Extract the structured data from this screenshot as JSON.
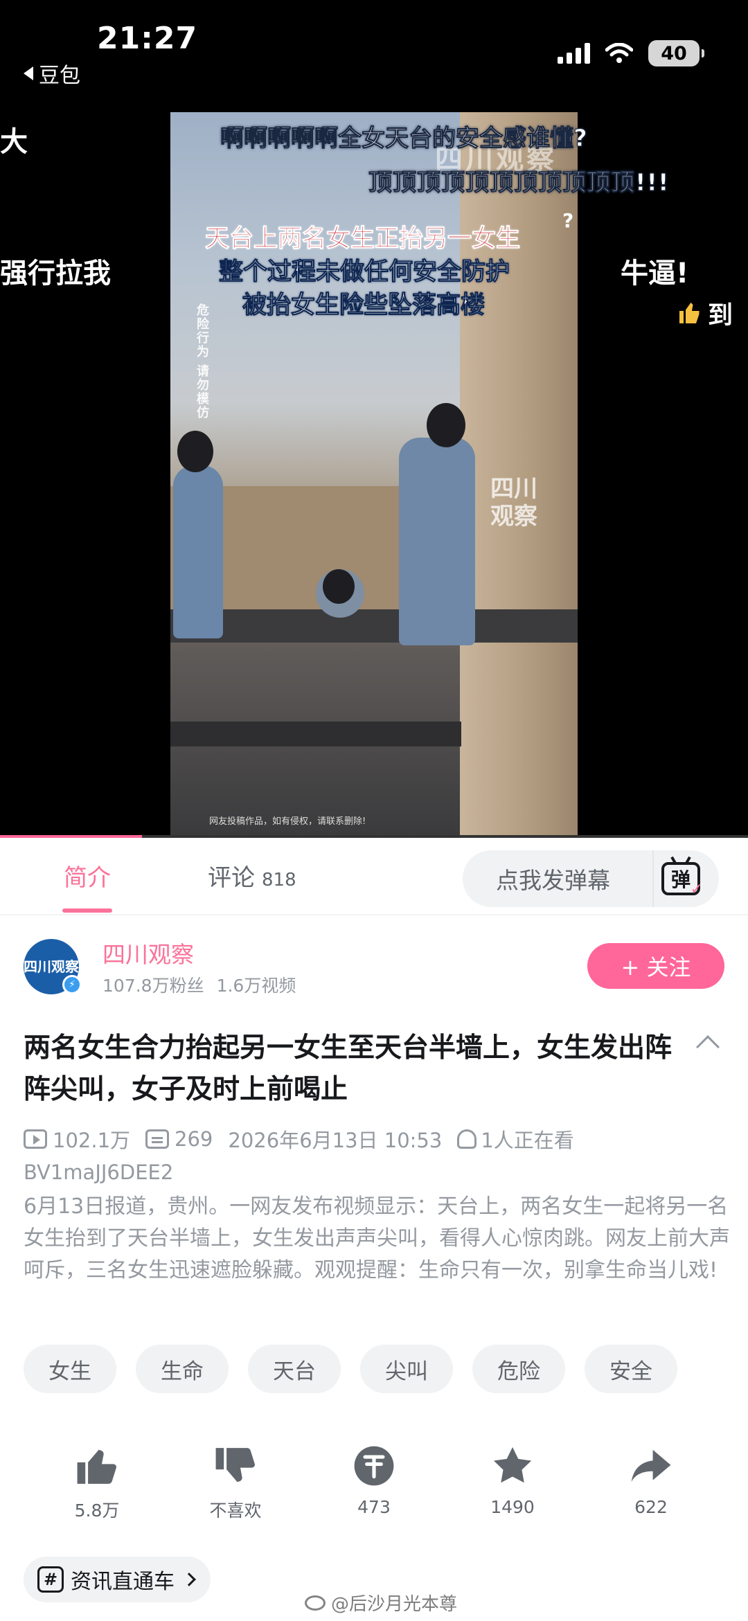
{
  "status_bar": {
    "time": "21:27",
    "back_app": "豆包",
    "battery": "40"
  },
  "video": {
    "overlay_top_line1": "啊啊啊啊啊全女天台的安全感谁懂?",
    "overlay_top_line2": "顶顶顶顶顶顶顶顶顶顶顶!!!",
    "overlay_question": "?",
    "caption_red": "天台上两名女生正抬另一女生",
    "caption_white_1": "整个过程未做任何安全防护",
    "caption_white_2": "被抬女生险些坠落高楼",
    "vertical_warning": "危险行为 请勿模仿",
    "watermark_top": "四川观察",
    "watermark_mid": "四川观察",
    "disclaimer": "网友投稿作品，如有侵权，请联系删除!",
    "progress": 0.19
  },
  "danmaku": {
    "left_top": "大",
    "left_mid": "强行拉我",
    "right_mid": "牛逼!",
    "right_lower": "到"
  },
  "tabs": {
    "intro": "简介",
    "comments": "评论",
    "comments_count": "818",
    "danmu_placeholder": "点我发弹幕",
    "danmu_button": "弹"
  },
  "uploader": {
    "avatar_text": "四川观察",
    "name": "四川观察",
    "fans": "107.8万粉丝",
    "videos": "1.6万视频",
    "follow": "+ 关注"
  },
  "title": "两名女生合力抬起另一女生至天台半墙上，女生发出阵阵尖叫，女子及时上前喝止",
  "meta": {
    "views": "102.1万",
    "danmaku_count": "269",
    "date": "2026年6月13日 10:53",
    "watching": "1人正在看",
    "bvid": "BV1maJJ6DEE2"
  },
  "description": "6月13日报道，贵州。一网友发布视频显示：天台上，两名女生一起将另一名女生抬到了天台半墙上，女生发出声声尖叫，看得人心惊肉跳。网友上前大声呵斥，三名女生迅速遮脸躲藏。观观提醒：生命只有一次，别拿生命当儿戏!",
  "tags": [
    "女生",
    "生命",
    "天台",
    "尖叫",
    "危险",
    "安全"
  ],
  "actions": {
    "like": "5.8万",
    "dislike": "不喜欢",
    "coin": "473",
    "favorite": "1490",
    "share": "622"
  },
  "channel": "资讯直通车",
  "watermark": "@后沙月光本尊",
  "colors": {
    "accent": "#fb7299",
    "follow": "#ff6699",
    "text_secondary": "#9499a0"
  }
}
